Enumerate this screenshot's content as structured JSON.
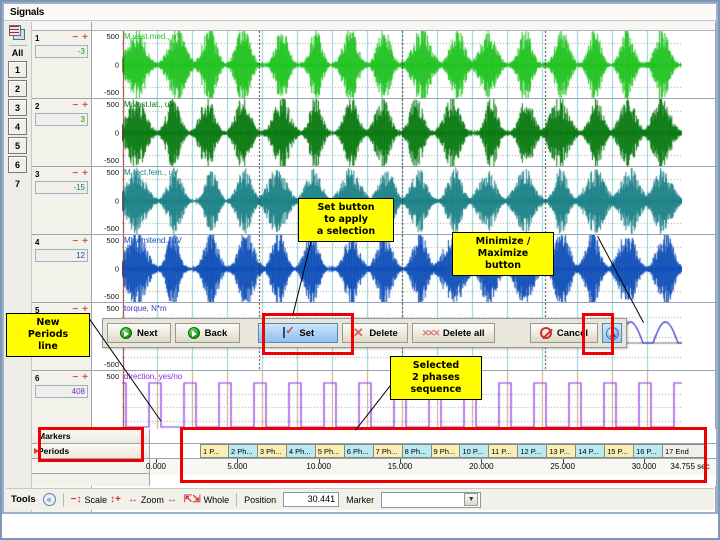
{
  "window": {
    "title": "Signals"
  },
  "rail": {
    "icon": "layers-icon",
    "all_label": "All",
    "buttons": [
      "1",
      "2",
      "3",
      "4",
      "5",
      "6",
      "7"
    ]
  },
  "channels": [
    {
      "num": "1",
      "value": "-3",
      "signal": "M.vast.med., uV",
      "color": "#22c322",
      "axis_top": "500",
      "axis_mid": "0",
      "axis_bot": "-500"
    },
    {
      "num": "2",
      "value": "3",
      "signal": "M.vast.lat., uV",
      "color": "#0a7a12",
      "axis_top": "500",
      "axis_mid": "0",
      "axis_bot": "-500"
    },
    {
      "num": "3",
      "value": "-15",
      "signal": "M.rect.fem., uV",
      "color": "#1d8287",
      "axis_top": "500",
      "axis_mid": "0",
      "axis_bot": "-500"
    },
    {
      "num": "4",
      "value": "12",
      "signal": "M.semitend., uV",
      "color": "#1050b8",
      "axis_top": "500",
      "axis_mid": "0",
      "axis_bot": "-500"
    },
    {
      "num": "5",
      "value": "",
      "signal": "torque, N*m",
      "color": "#3a3ac0",
      "axis_top": "500",
      "axis_mid": "0",
      "axis_bot": "-500"
    },
    {
      "num": "6",
      "value": "408",
      "signal": "direction, yes/no",
      "color": "#8a2be2",
      "axis_top": "500",
      "axis_mid": "",
      "axis_bot": "0"
    }
  ],
  "toolbar": {
    "next_label": "Next",
    "back_label": "Back",
    "set_label": "Set",
    "delete_label": "Delete",
    "delete_all_label": "Delete all",
    "cancel_label": "Cancel",
    "minmax_icon": "minimize-maximize-icon"
  },
  "tracks": {
    "markers_label": "Markers",
    "periods_label": "Periods",
    "periods": [
      {
        "label": "1 P...",
        "style": "a"
      },
      {
        "label": "2 Ph...",
        "style": "b"
      },
      {
        "label": "3 Ph...",
        "style": "a"
      },
      {
        "label": "4 Ph...",
        "style": "b"
      },
      {
        "label": "5 Ph...",
        "style": "a"
      },
      {
        "label": "6 Ph...",
        "style": "b"
      },
      {
        "label": "7 Ph...",
        "style": "a"
      },
      {
        "label": "8 Ph...",
        "style": "b"
      },
      {
        "label": "9 Ph...",
        "style": "a"
      },
      {
        "label": "10 P...",
        "style": "b"
      },
      {
        "label": "11 P...",
        "style": "a"
      },
      {
        "label": "12 P...",
        "style": "b"
      },
      {
        "label": "13 P...",
        "style": "a"
      },
      {
        "label": "14 P...",
        "style": "b"
      },
      {
        "label": "15 P...",
        "style": "a"
      },
      {
        "label": "16 P...",
        "style": "b"
      },
      {
        "label": "17 End",
        "style": "end"
      }
    ],
    "time_ticks": [
      "0.000",
      "5.000",
      "10.000",
      "15.000",
      "20.000",
      "25.000",
      "30.000"
    ],
    "time_end": "34.755 sec"
  },
  "tools": {
    "label": "Tools",
    "collapse_icon": "collapse-icon",
    "scale_label": "Scale",
    "zoom_label": "Zoom",
    "whole_label": "Whole",
    "position_label": "Position",
    "position_value": "30.441",
    "marker_label": "Marker",
    "marker_value": ""
  },
  "callouts": {
    "set_button": "Set button\nto apply\na selection",
    "set_button_lines": [
      "Set button",
      "to apply",
      "a selection"
    ],
    "minmax": [
      "Minimize /",
      "Maximize",
      "button"
    ],
    "new_periods": [
      "New",
      "Periods",
      "line"
    ],
    "selected": [
      "Selected",
      "2 phases",
      "sequence"
    ]
  },
  "colors": {
    "highlight_box": "#ee0000",
    "callout_bg": "#ffff00",
    "accent": "#8fc1ef"
  }
}
